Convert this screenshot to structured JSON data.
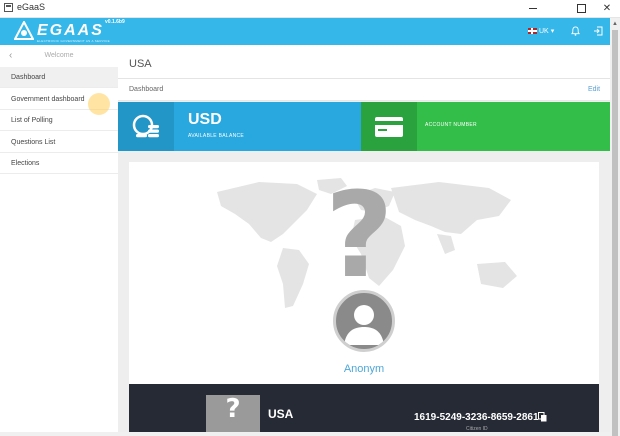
{
  "window": {
    "title": "eGaaS",
    "min_label": "",
    "max_label": "",
    "close_label": "✕"
  },
  "header": {
    "logo_text": "EGAAS",
    "logo_tagline": "ELECTRONIC GOVERNMENT AS A SERVICE",
    "version": "v0.1.6b9",
    "language": "UK",
    "language_caret": "▾"
  },
  "sidebar": {
    "back_arrow": "‹",
    "back_label": "Welcome",
    "items": [
      {
        "label": "Dashboard",
        "active": true
      },
      {
        "label": "Government dashboard",
        "active": false
      },
      {
        "label": "List of Polling",
        "active": false
      },
      {
        "label": "Questions List",
        "active": false
      },
      {
        "label": "Elections",
        "active": false
      }
    ]
  },
  "main": {
    "page_title": "USA",
    "breadcrumb": "Dashboard",
    "edit_label": "Edit",
    "balance_card": {
      "title": "USD",
      "subtitle": "AVAILABLE BALANCE",
      "color": "#29a8df",
      "icon": "coins-icon"
    },
    "account_card": {
      "subtitle": "ACCOUNT NUMBER",
      "color": "#33be4a",
      "icon": "credit-card-icon"
    },
    "profile": {
      "name": "Anonym",
      "icon": "world-map-icon"
    },
    "id_card": {
      "photo_placeholder": "?",
      "country": "USA",
      "citizen_number": "1619-5249-3236-8659-2861",
      "citizen_caption": "Citizen ID"
    }
  },
  "colors": {
    "header": "#35b7ea",
    "accent": "#4ea7d8"
  }
}
